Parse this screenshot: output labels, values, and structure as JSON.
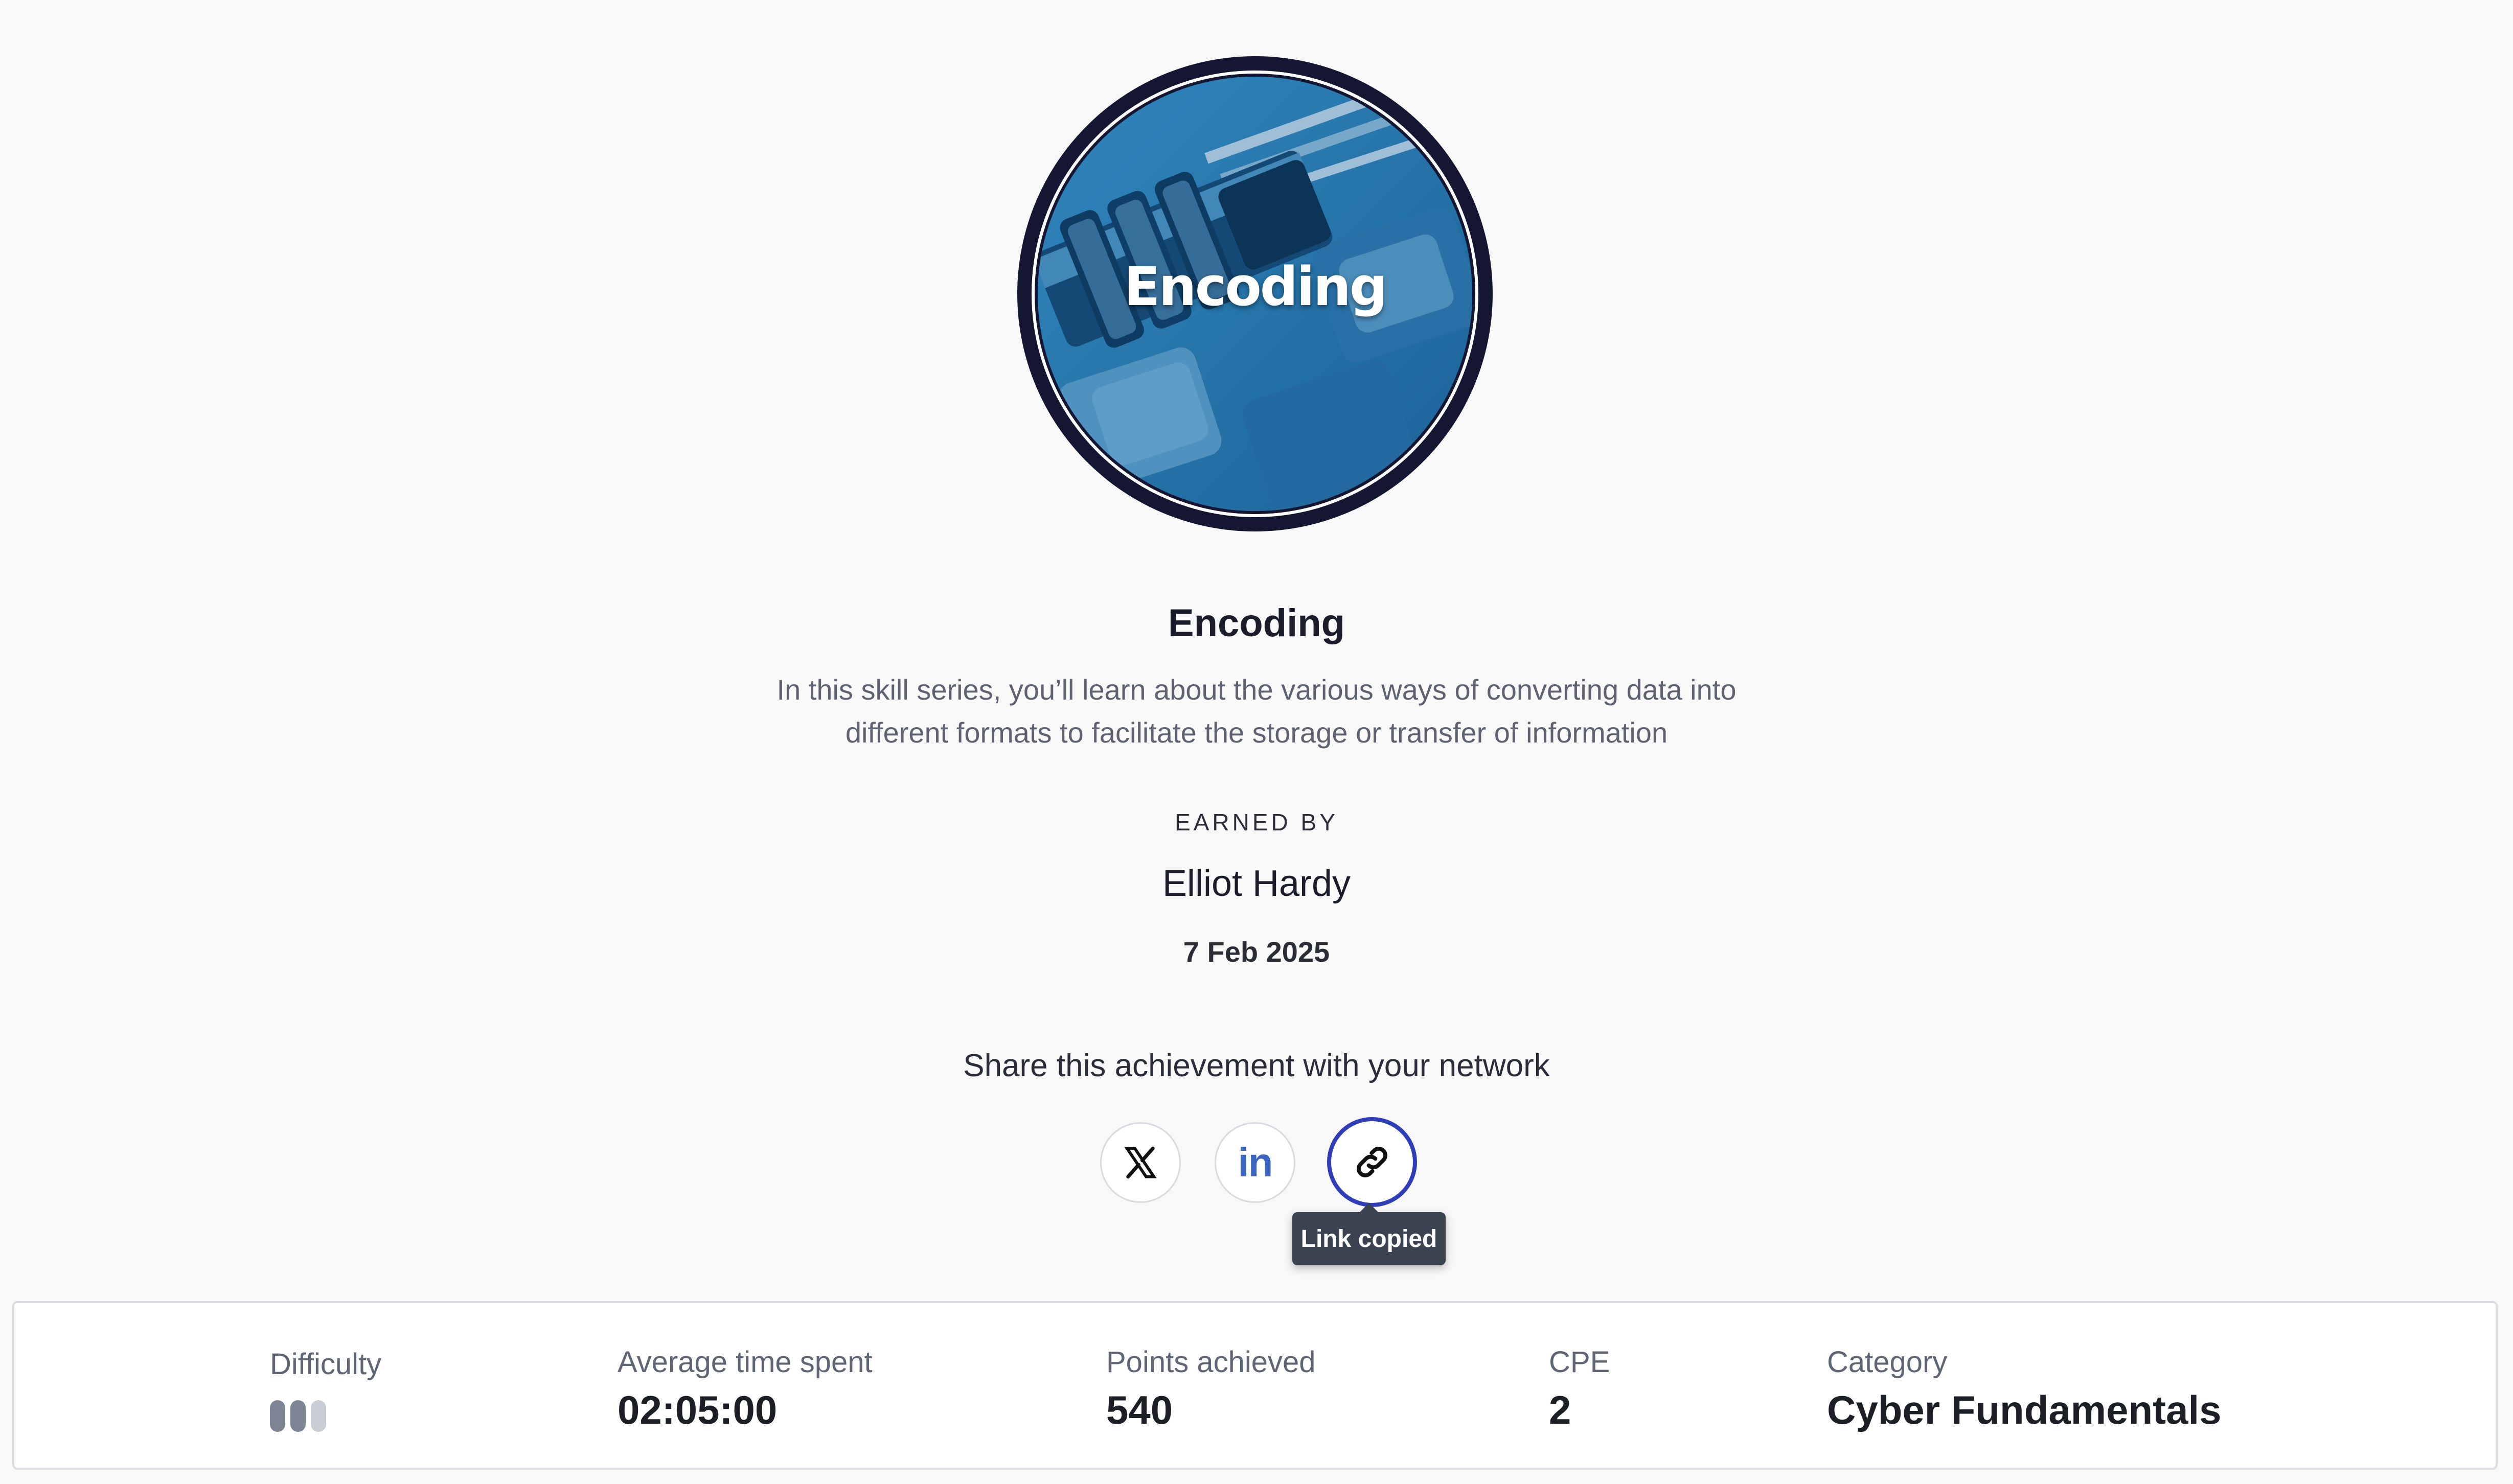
{
  "badge": {
    "title": "Encoding",
    "image": "combination-padlock-on-keyboard",
    "colors": {
      "ring": "#151631",
      "tint": "#2c85c3"
    }
  },
  "achievement": {
    "title": "Encoding",
    "description_line1": "In this skill series, you’ll learn about the various ways of converting data into",
    "description_line2": "different formats to facilitate the storage or transfer of information",
    "earned_by_label": "EARNED BY",
    "earner_name": "Elliot Hardy",
    "date": "7 Feb 2025"
  },
  "share": {
    "heading": "Share this achievement with your network",
    "buttons": [
      {
        "name": "x-icon"
      },
      {
        "name": "linkedin-icon",
        "glyph": "in"
      },
      {
        "name": "link-icon"
      }
    ],
    "tooltip": "Link copied",
    "colors": {
      "focus_ring": "#2f3db8",
      "linkedin": "#3a66c0"
    }
  },
  "stats": {
    "difficulty": {
      "label": "Difficulty",
      "level": 2,
      "max": 3
    },
    "time": {
      "label": "Average time spent",
      "value": "02:05:00"
    },
    "points": {
      "label": "Points achieved",
      "value": "540"
    },
    "cpe": {
      "label": "CPE",
      "value": "2"
    },
    "category": {
      "label": "Category",
      "value": "Cyber Fundamentals"
    }
  }
}
